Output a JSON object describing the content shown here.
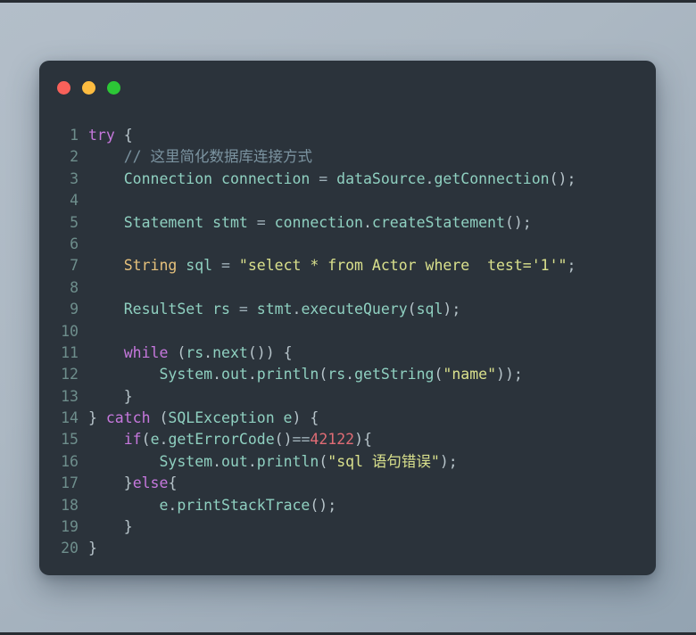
{
  "window": {
    "controls": [
      {
        "name": "close-button",
        "label": "close",
        "color": "#f8615a"
      },
      {
        "name": "minimize-button",
        "label": "minimize",
        "color": "#fdbc40"
      },
      {
        "name": "maximize-button",
        "label": "maximize",
        "color": "#2cc736"
      }
    ],
    "background": "#2b333b"
  },
  "theme": {
    "wallpaper_top": "#b3bec9",
    "wallpaper_bottom": "#93a3b1",
    "line_number": "#6e8e8c",
    "identifier": "#8fd0c0",
    "keyword": "#c678dd",
    "type": "#e5c07b",
    "string": "#d9e08c",
    "number": "#e06c75",
    "comment": "#7b93a0",
    "punctuation": "#b7c4ca"
  },
  "editor": {
    "language": "java",
    "total_lines": 20,
    "lines": [
      {
        "n": "1",
        "tokens": [
          {
            "c": "kw",
            "t": "try"
          },
          {
            "c": "plain",
            "t": " "
          },
          {
            "c": "punct",
            "t": "{"
          }
        ]
      },
      {
        "n": "2",
        "tokens": [
          {
            "c": "plain",
            "t": "    "
          },
          {
            "c": "cmt",
            "t": "// 这里简化数据库连接方式"
          }
        ]
      },
      {
        "n": "3",
        "tokens": [
          {
            "c": "plain",
            "t": "    "
          },
          {
            "c": "ident",
            "t": "Connection connection "
          },
          {
            "c": "op",
            "t": "="
          },
          {
            "c": "ident",
            "t": " dataSource"
          },
          {
            "c": "punct",
            "t": "."
          },
          {
            "c": "ident",
            "t": "getConnection"
          },
          {
            "c": "punct",
            "t": "();"
          }
        ]
      },
      {
        "n": "4",
        "tokens": [
          {
            "c": "plain",
            "t": ""
          }
        ]
      },
      {
        "n": "5",
        "tokens": [
          {
            "c": "plain",
            "t": "    "
          },
          {
            "c": "ident",
            "t": "Statement stmt "
          },
          {
            "c": "op",
            "t": "="
          },
          {
            "c": "ident",
            "t": " connection"
          },
          {
            "c": "punct",
            "t": "."
          },
          {
            "c": "ident",
            "t": "createStatement"
          },
          {
            "c": "punct",
            "t": "();"
          }
        ]
      },
      {
        "n": "6",
        "tokens": [
          {
            "c": "plain",
            "t": ""
          }
        ]
      },
      {
        "n": "7",
        "tokens": [
          {
            "c": "plain",
            "t": "    "
          },
          {
            "c": "type",
            "t": "String"
          },
          {
            "c": "plain",
            "t": " "
          },
          {
            "c": "ident",
            "t": "sql"
          },
          {
            "c": "plain",
            "t": " "
          },
          {
            "c": "op",
            "t": "="
          },
          {
            "c": "plain",
            "t": " "
          },
          {
            "c": "str",
            "t": "\"select * from Actor where  test='1'\""
          },
          {
            "c": "punct",
            "t": ";"
          }
        ]
      },
      {
        "n": "8",
        "tokens": [
          {
            "c": "plain",
            "t": ""
          }
        ]
      },
      {
        "n": "9",
        "tokens": [
          {
            "c": "plain",
            "t": "    "
          },
          {
            "c": "ident",
            "t": "ResultSet rs "
          },
          {
            "c": "op",
            "t": "="
          },
          {
            "c": "ident",
            "t": " stmt"
          },
          {
            "c": "punct",
            "t": "."
          },
          {
            "c": "ident",
            "t": "executeQuery"
          },
          {
            "c": "punct",
            "t": "("
          },
          {
            "c": "ident",
            "t": "sql"
          },
          {
            "c": "punct",
            "t": ");"
          }
        ]
      },
      {
        "n": "10",
        "tokens": [
          {
            "c": "plain",
            "t": ""
          }
        ]
      },
      {
        "n": "11",
        "tokens": [
          {
            "c": "plain",
            "t": "    "
          },
          {
            "c": "kw",
            "t": "while"
          },
          {
            "c": "plain",
            "t": " "
          },
          {
            "c": "punct",
            "t": "("
          },
          {
            "c": "ident",
            "t": "rs"
          },
          {
            "c": "punct",
            "t": "."
          },
          {
            "c": "ident",
            "t": "next"
          },
          {
            "c": "punct",
            "t": "()) {"
          }
        ]
      },
      {
        "n": "12",
        "tokens": [
          {
            "c": "plain",
            "t": "        "
          },
          {
            "c": "ident",
            "t": "System"
          },
          {
            "c": "punct",
            "t": "."
          },
          {
            "c": "ident",
            "t": "out"
          },
          {
            "c": "punct",
            "t": "."
          },
          {
            "c": "ident",
            "t": "println"
          },
          {
            "c": "punct",
            "t": "("
          },
          {
            "c": "ident",
            "t": "rs"
          },
          {
            "c": "punct",
            "t": "."
          },
          {
            "c": "ident",
            "t": "getString"
          },
          {
            "c": "punct",
            "t": "("
          },
          {
            "c": "str",
            "t": "\"name\""
          },
          {
            "c": "punct",
            "t": "));"
          }
        ]
      },
      {
        "n": "13",
        "tokens": [
          {
            "c": "plain",
            "t": "    "
          },
          {
            "c": "punct",
            "t": "}"
          }
        ]
      },
      {
        "n": "14",
        "tokens": [
          {
            "c": "punct",
            "t": "} "
          },
          {
            "c": "kw",
            "t": "catch"
          },
          {
            "c": "plain",
            "t": " "
          },
          {
            "c": "punct",
            "t": "("
          },
          {
            "c": "ident",
            "t": "SQLException e"
          },
          {
            "c": "punct",
            "t": ") {"
          }
        ]
      },
      {
        "n": "15",
        "tokens": [
          {
            "c": "plain",
            "t": "    "
          },
          {
            "c": "kw",
            "t": "if"
          },
          {
            "c": "punct",
            "t": "("
          },
          {
            "c": "ident",
            "t": "e"
          },
          {
            "c": "punct",
            "t": "."
          },
          {
            "c": "ident",
            "t": "getErrorCode"
          },
          {
            "c": "punct",
            "t": "()"
          },
          {
            "c": "op",
            "t": "=="
          },
          {
            "c": "num",
            "t": "42122"
          },
          {
            "c": "punct",
            "t": "){"
          }
        ]
      },
      {
        "n": "16",
        "tokens": [
          {
            "c": "plain",
            "t": "        "
          },
          {
            "c": "ident",
            "t": "System"
          },
          {
            "c": "punct",
            "t": "."
          },
          {
            "c": "ident",
            "t": "out"
          },
          {
            "c": "punct",
            "t": "."
          },
          {
            "c": "ident",
            "t": "println"
          },
          {
            "c": "punct",
            "t": "("
          },
          {
            "c": "str",
            "t": "\"sql 语句错误\""
          },
          {
            "c": "punct",
            "t": ");"
          }
        ]
      },
      {
        "n": "17",
        "tokens": [
          {
            "c": "plain",
            "t": "    "
          },
          {
            "c": "punct",
            "t": "}"
          },
          {
            "c": "kw",
            "t": "else"
          },
          {
            "c": "punct",
            "t": "{"
          }
        ]
      },
      {
        "n": "18",
        "tokens": [
          {
            "c": "plain",
            "t": "        "
          },
          {
            "c": "ident",
            "t": "e"
          },
          {
            "c": "punct",
            "t": "."
          },
          {
            "c": "ident",
            "t": "printStackTrace"
          },
          {
            "c": "punct",
            "t": "();"
          }
        ]
      },
      {
        "n": "19",
        "tokens": [
          {
            "c": "plain",
            "t": "    "
          },
          {
            "c": "punct",
            "t": "}"
          }
        ]
      },
      {
        "n": "20",
        "tokens": [
          {
            "c": "punct",
            "t": "}"
          }
        ]
      }
    ]
  }
}
